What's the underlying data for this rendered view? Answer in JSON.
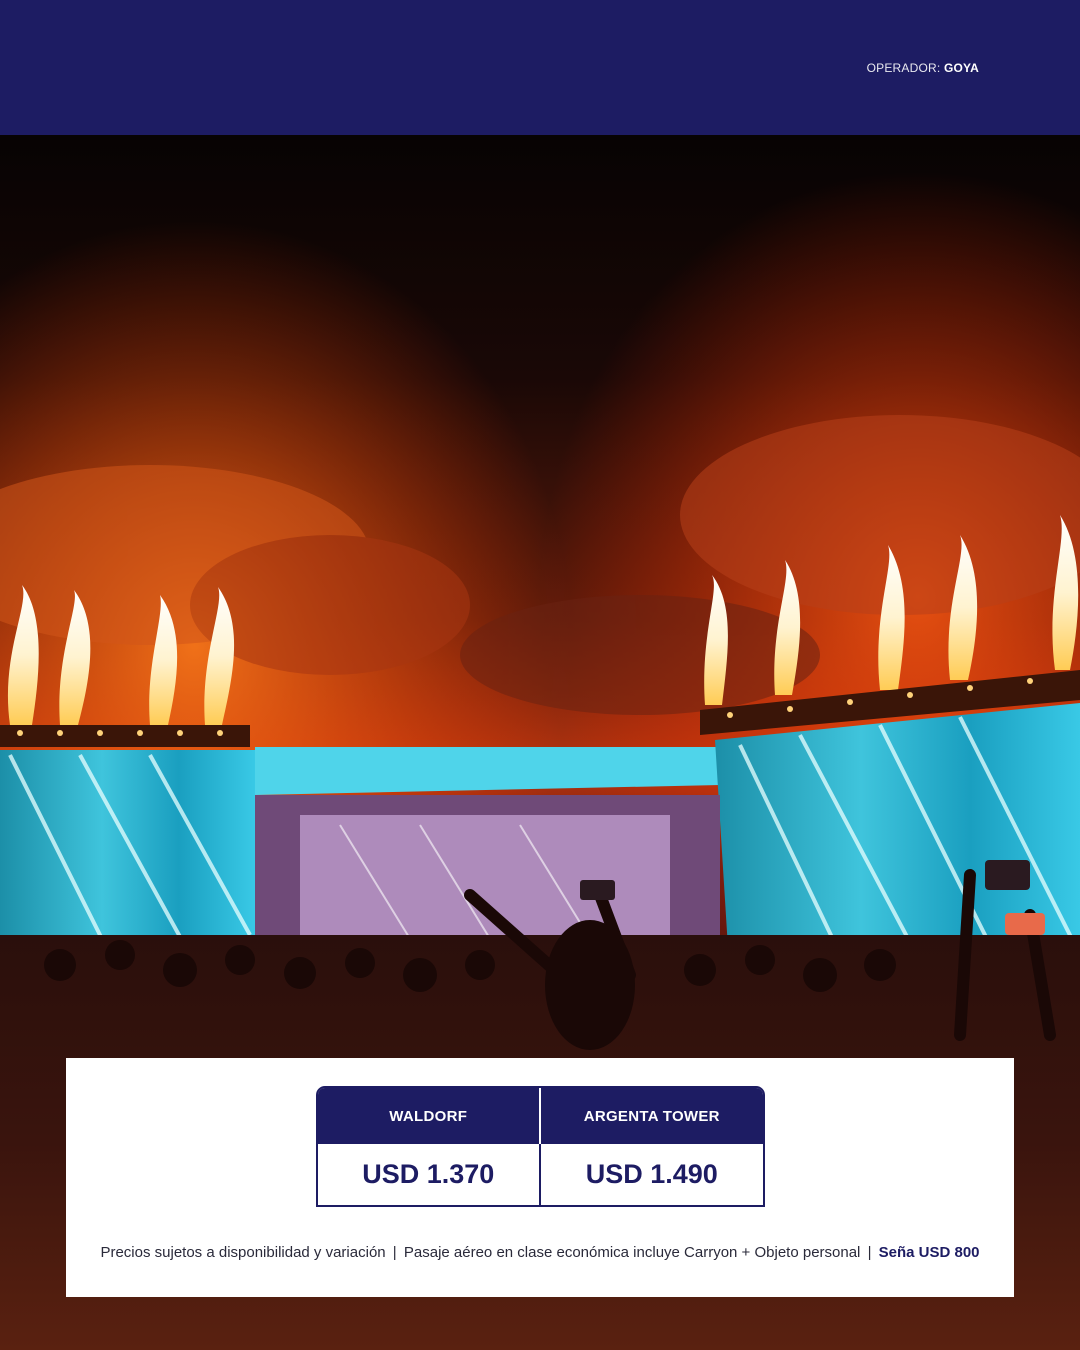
{
  "header": {
    "operator_label": "OPERADOR:",
    "operator_name": "GOYA",
    "background_color": "#1d1c63"
  },
  "hero_image": {
    "description_icon": "concert-photo"
  },
  "price_table": {
    "columns": [
      {
        "hotel": "WALDORF",
        "price": "USD 1.370"
      },
      {
        "hotel": "ARGENTA TOWER",
        "price": "USD 1.490"
      }
    ],
    "accent_color": "#1d1c63"
  },
  "disclaimer": {
    "text_1": "Precios sujetos a disponibilidad y variación",
    "separator": "|",
    "text_2": "Pasaje aéreo en clase económica incluye Carryon + Objeto personal",
    "deposit": "Seña USD 800"
  }
}
